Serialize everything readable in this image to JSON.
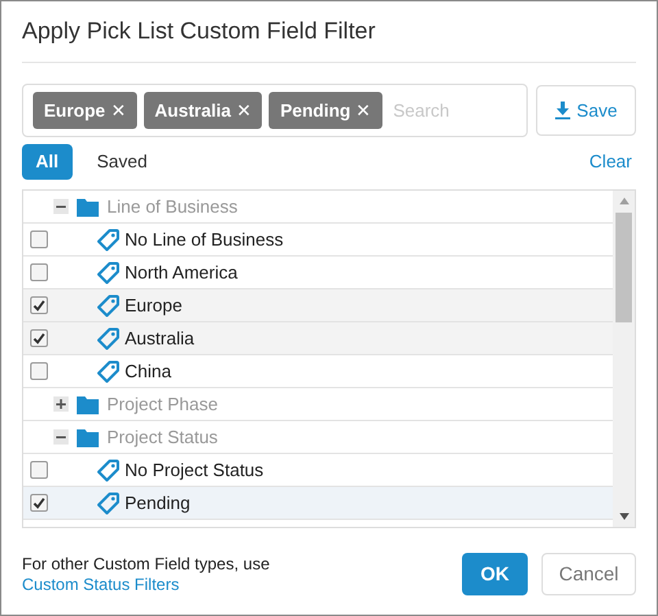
{
  "dialog": {
    "title": "Apply Pick List Custom Field Filter"
  },
  "tags": [
    {
      "label": "Europe",
      "remove": "✕"
    },
    {
      "label": "Australia",
      "remove": "✕"
    },
    {
      "label": "Pending",
      "remove": "✕"
    }
  ],
  "search": {
    "placeholder": "Search"
  },
  "save_button": "Save",
  "tabs": [
    {
      "label": "All",
      "selected": true
    },
    {
      "label": "Saved",
      "selected": false
    }
  ],
  "clear_link": "Clear",
  "tree": [
    {
      "label": "Line of Business",
      "expanded": true,
      "children": [
        {
          "label": "No Line of Business",
          "checked": false,
          "hovered": false
        },
        {
          "label": "North America",
          "checked": false,
          "hovered": false
        },
        {
          "label": "Europe",
          "checked": true,
          "hovered": false
        },
        {
          "label": "Australia",
          "checked": true,
          "hovered": false
        },
        {
          "label": "China",
          "checked": false,
          "hovered": false
        }
      ]
    },
    {
      "label": "Project Phase",
      "expanded": false
    },
    {
      "label": "Project Status",
      "expanded": true,
      "children": [
        {
          "label": "No Project Status",
          "checked": false,
          "hovered": false
        },
        {
          "label": "Pending",
          "checked": true,
          "hovered": true
        }
      ]
    }
  ],
  "footer": {
    "note": "For other Custom Field types, use",
    "link": "Custom Status Filters"
  },
  "buttons": {
    "ok": "OK",
    "cancel": "Cancel"
  }
}
